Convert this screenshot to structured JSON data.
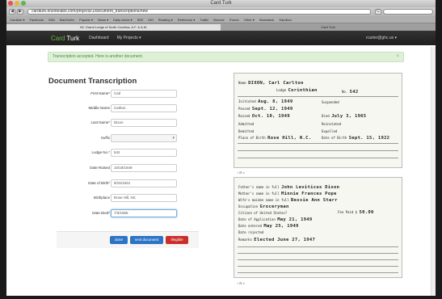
{
  "window": {
    "title": "Card Turk"
  },
  "toolbar": {
    "back": "◀",
    "forward": "▶",
    "url": "cardturk.enzotelabs.com/projects/1/document_transcriptions/new",
    "reload": "C"
  },
  "bookmarks": [
    "Cardturk ▾",
    "Facebook",
    "Wiki",
    "MacSurfer",
    "Popular ▾",
    "News ▾",
    "Daily check ▾",
    "SMI",
    "UNI",
    "Reading ▾",
    "Reference ▾",
    "Traffic",
    "Bounce",
    "iTunes",
    "Other ▾",
    "Newsdesk",
    "Sandbox"
  ],
  "tabs": {
    "active": "NC Grand Lodge of North Carolina, A.F. & A.M.",
    "other": "Card Turk"
  },
  "nav": {
    "brand_a": "Card",
    "brand_b": "Turk",
    "dashboard": "Dashboard",
    "projects": "My Projects ▾",
    "user": "rcarter@ghc.us ▾"
  },
  "alert": {
    "text": "Transcription accepted. Here is another document.",
    "close": "×"
  },
  "page_title": "Document Transcription",
  "form": {
    "first_name": {
      "label": "First Name*",
      "value": "Carl"
    },
    "middle_name": {
      "label": "Middle Name",
      "value": "Carlton"
    },
    "last_name": {
      "label": "Last Name*",
      "value": "Dixon"
    },
    "suffix": {
      "label": "Suffix",
      "value": ""
    },
    "lodge_no": {
      "label": "Lodge No.*",
      "value": "542"
    },
    "date_raised": {
      "label": "Date Raised",
      "value": "10/18/1949"
    },
    "date_of_birth": {
      "label": "Date of Birth*",
      "value": "9/15/1922"
    },
    "birthplace": {
      "label": "Birthplace",
      "value": "Rose Hill, NC"
    },
    "date_died": {
      "label": "Date Died*",
      "value": "7/3/1965"
    }
  },
  "buttons": {
    "done": "done",
    "next": "next document",
    "illegible": "Illegible"
  },
  "card_front": {
    "name_label": "Name",
    "name_value": "DIXON, Carl Carlton",
    "lodge_label": "Lodge",
    "lodge_value": "Corinthian",
    "no_label": "No.",
    "no_value": "542",
    "initiated_label": "Initiated",
    "initiated_value": "Aug. 8, 1949",
    "passed_label": "Passed",
    "passed_value": "Sept. 12, 1949",
    "raised_label": "Raised",
    "raised_value": "Oct. 10, 1949",
    "suspended_label": "Suspended",
    "died_label": "Died",
    "died_value": "July 3, 1965",
    "admitted_label": "Admitted",
    "demitted_label": "Demitted",
    "reinstated_label": "Reinstated",
    "expelled_label": "Expelled",
    "pob_label": "Place of Birth",
    "pob_value": "Rose Hill, N.C.",
    "dob_label": "Date of Birth",
    "dob_value": "Sept. 15, 1922"
  },
  "card_back": {
    "father_label": "Father's name in full",
    "father_value": "John Leviticus Dixon",
    "mother_label": "Mother's name in full",
    "mother_value": "Minnie Frances Pope",
    "wife_label": "Wife's maiden name in full",
    "wife_value": "Bessie Ann Starr",
    "occupation_label": "Occupation",
    "occupation_value": "Groceryman",
    "citizen_label": "Citizen of United States?",
    "fee_label": "Fee Paid $",
    "fee_value": "50.00",
    "application_label": "Date of Application",
    "application_value": "May 21, 1949",
    "entered_label": "Date entered",
    "entered_value": "May 25, 1949",
    "rejected_label": "Date rejected",
    "remarks_label": "Remarks",
    "remarks_value": "Elected June 27, 1947"
  },
  "zoom_controls": "↕ ⊟ ⌕"
}
